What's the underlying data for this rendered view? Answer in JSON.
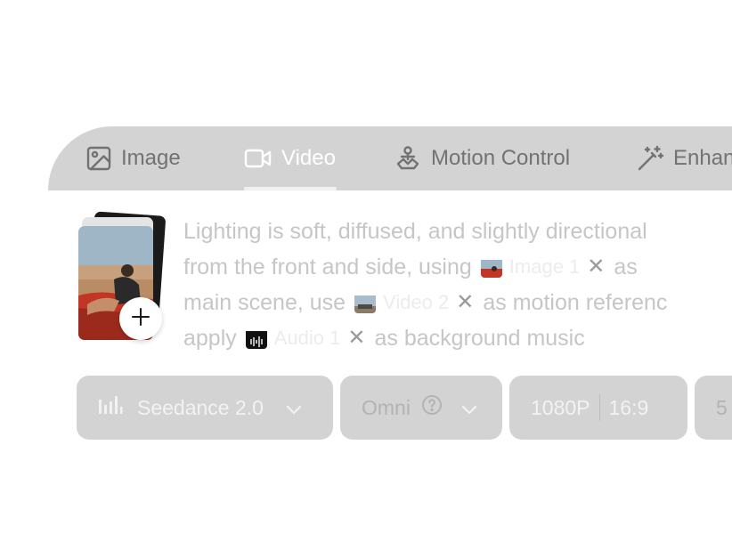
{
  "tabs": [
    {
      "label": "Image",
      "icon": "image-icon",
      "active": false
    },
    {
      "label": "Video",
      "icon": "video-camera-icon",
      "active": true
    },
    {
      "label": "Motion Control",
      "icon": "motion-control-icon",
      "active": false
    },
    {
      "label": "Enhan",
      "icon": "magic-wand-icon",
      "active": false
    }
  ],
  "prompt": {
    "line1": "Lighting is soft, diffused, and slightly directional",
    "line2_pre": "from the front and side, using",
    "chip1_label": "Image 1",
    "line2_post": "as",
    "line3_pre": "main scene, use",
    "chip2_label": "Video 2",
    "line3_post": "as motion referenc",
    "line4_pre": "apply",
    "chip3_label": "Audio 1",
    "line4_post": "as background music"
  },
  "toolbar": {
    "model_label": "Seedance 2.0",
    "mode_label": "Omni",
    "resolution_label": "1080P",
    "ratio_label": "16:9",
    "duration_label": "5"
  },
  "colors": {
    "bar_bg": "#d3d3d3",
    "inactive_tab_text": "#727272",
    "active_tab_text": "#ffffff",
    "prompt_text": "#c6c6c6"
  }
}
